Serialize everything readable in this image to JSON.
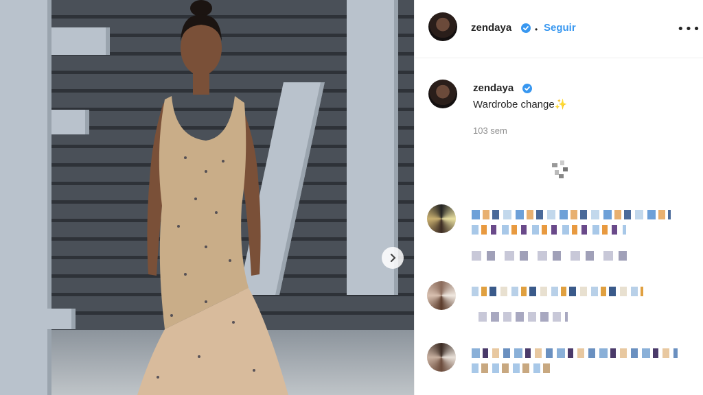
{
  "post": {
    "username": "zendaya",
    "follow_label": "Seguir",
    "separator": "•",
    "more_label": "•••",
    "caption": "Wardrobe change",
    "caption_emoji": "✨",
    "timestamp": "103 sem"
  },
  "icons": {
    "verified": "verified-badge-icon",
    "next": "chevron-right-icon",
    "more": "more-options-icon",
    "loading": "loading-spinner-icon"
  },
  "colors": {
    "link": "#3897f0",
    "text": "#262626",
    "muted": "#8e8e8e",
    "verified": "#3897f0"
  }
}
